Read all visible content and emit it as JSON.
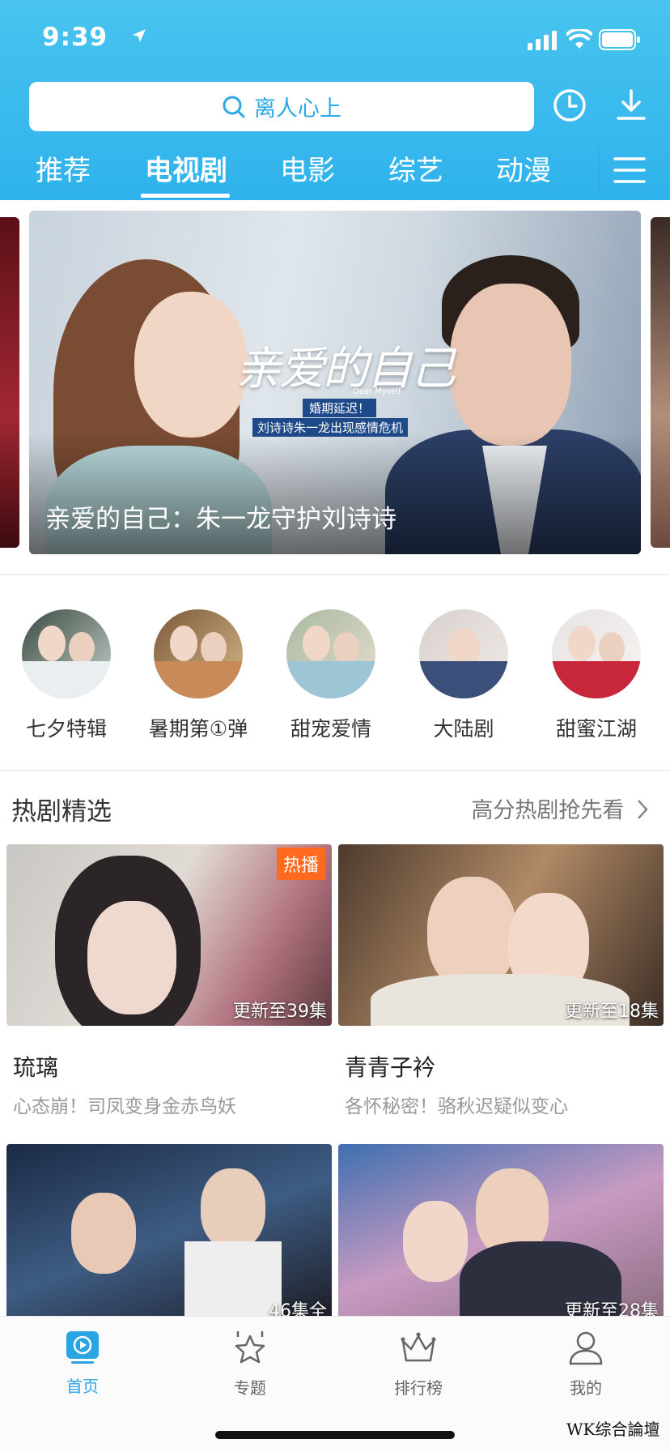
{
  "status_bar": {
    "time": "9:39"
  },
  "search": {
    "placeholder": "离人心上"
  },
  "tabs": [
    {
      "label": "推荐",
      "active": false
    },
    {
      "label": "电视剧",
      "active": true
    },
    {
      "label": "电影",
      "active": false
    },
    {
      "label": "综艺",
      "active": false
    },
    {
      "label": "动漫",
      "active": false
    }
  ],
  "banner": {
    "logo_title": "亲爱的自己",
    "logo_en": "Dear Myself",
    "logo_sub1": "婚期延迟！",
    "logo_sub2": "刘诗诗朱一龙出现感情危机",
    "caption": "亲爱的自己：朱一龙守护刘诗诗"
  },
  "categories": [
    {
      "label": "七夕特辑"
    },
    {
      "label": "暑期第①弹"
    },
    {
      "label": "甜宠爱情"
    },
    {
      "label": "大陆剧"
    },
    {
      "label": "甜蜜江湖"
    }
  ],
  "section": {
    "title": "热剧精选",
    "more": "高分热剧抢先看"
  },
  "cards": [
    {
      "title": "琉璃",
      "subtitle": "心态崩！司凤变身金赤鸟妖",
      "episodes": "更新至39集",
      "badge": "热播"
    },
    {
      "title": "青青子衿",
      "subtitle": "各怀秘密！骆秋迟疑似变心",
      "episodes": "更新至18集"
    },
    {
      "title": "",
      "subtitle": "",
      "episodes": "46集全"
    },
    {
      "title": "",
      "subtitle": "",
      "episodes": "更新至28集"
    }
  ],
  "tabbar": [
    {
      "label": "首页",
      "icon": "play-screen-icon",
      "active": true
    },
    {
      "label": "专题",
      "icon": "star-icon",
      "active": false
    },
    {
      "label": "排行榜",
      "icon": "crown-icon",
      "active": false
    },
    {
      "label": "我的",
      "icon": "user-icon",
      "active": false
    }
  ],
  "watermark": "WK综合論壇",
  "colors": {
    "header": "#3bbbee",
    "accent": "#2aa4e2",
    "badge": "#ff6a1f"
  }
}
